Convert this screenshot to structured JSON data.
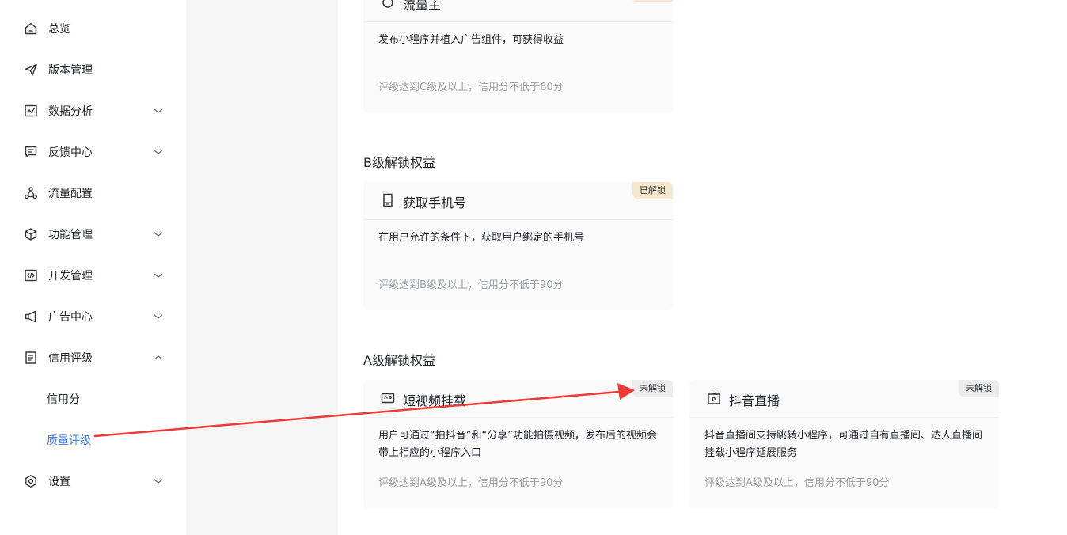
{
  "sidebar": {
    "items": [
      {
        "label": "总览",
        "icon": "home-icon"
      },
      {
        "label": "版本管理",
        "icon": "send-icon"
      },
      {
        "label": "数据分析",
        "icon": "chart-icon"
      },
      {
        "label": "反馈中心",
        "icon": "message-icon"
      },
      {
        "label": "流量配置",
        "icon": "traffic-icon"
      },
      {
        "label": "功能管理",
        "icon": "cube-icon"
      },
      {
        "label": "开发管理",
        "icon": "code-icon"
      },
      {
        "label": "广告中心",
        "icon": "megaphone-icon"
      },
      {
        "label": "信用评级",
        "icon": "document-icon"
      },
      {
        "label": "设置",
        "icon": "gear-icon"
      }
    ],
    "sub_items": [
      {
        "label": "信用分"
      },
      {
        "label": "质量评级"
      }
    ]
  },
  "sections": {
    "c_card": {
      "title": "流量主",
      "desc": "发布小程序并植入广告组件，可获得收益",
      "req": "评级达到C级及以上，信用分不低于60分"
    },
    "b": {
      "title": "B级解锁权益",
      "card": {
        "title": "获取手机号",
        "badge": "已解锁",
        "desc": "在用户允许的条件下，获取用户绑定的手机号",
        "req": "评级达到B级及以上，信用分不低于90分"
      }
    },
    "a": {
      "title": "A级解锁权益",
      "cards": [
        {
          "title": "短视频挂载",
          "badge": "未解锁",
          "desc": "用户可通过“拍抖音”和“分享”功能拍摄视频，发布后的视频会带上相应的小程序入口",
          "req": "评级达到A级及以上，信用分不低于90分"
        },
        {
          "title": "抖音直播",
          "badge": "未解锁",
          "desc": "抖音直播间支持跳转小程序，可通过自有直播间、达人直播间挂载小程序延展服务",
          "req": "评级达到A级及以上，信用分不低于90分"
        }
      ]
    }
  },
  "colors": {
    "accent": "#3c7ce8",
    "annotation_arrow": "#ef3b36",
    "badge_unlocked": "#f5e8cf",
    "badge_locked": "#ececec"
  }
}
